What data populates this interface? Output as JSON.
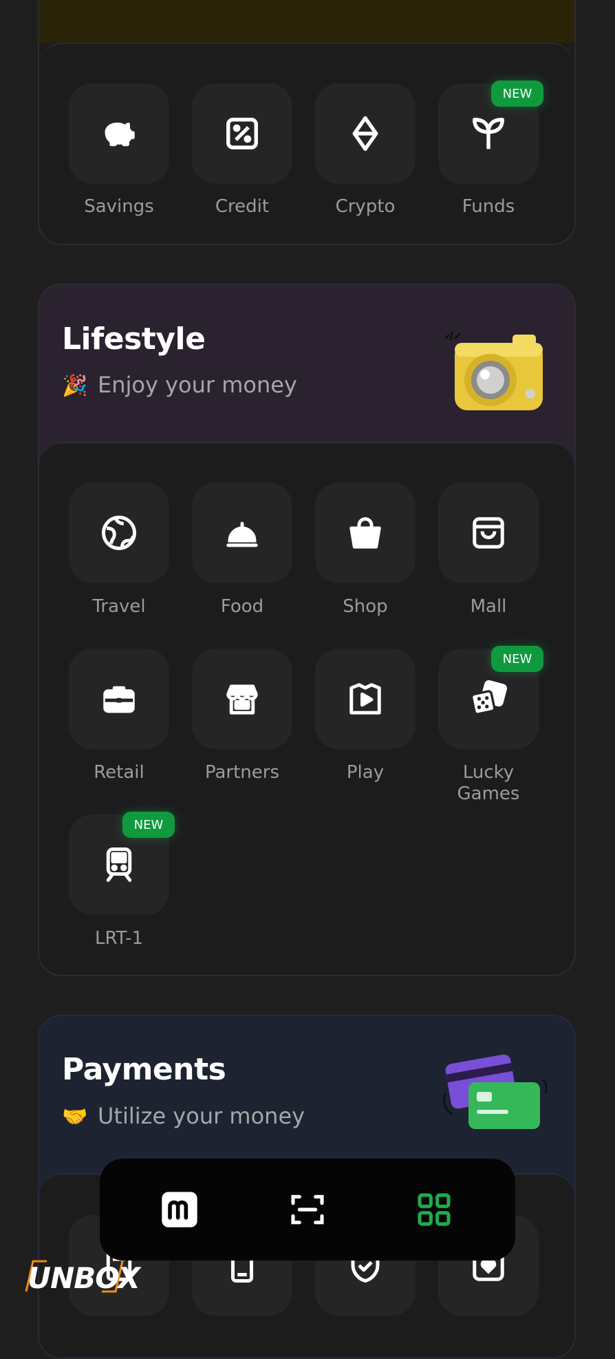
{
  "colors": {
    "background": "#1e1e1f",
    "badge": "#0f9a3e",
    "active_nav": "#1faa4e"
  },
  "top_section": {
    "items": [
      {
        "label": "Savings",
        "icon": "piggy-bank-icon"
      },
      {
        "label": "Credit",
        "icon": "percent-icon"
      },
      {
        "label": "Crypto",
        "icon": "diamond-icon"
      },
      {
        "label": "Funds",
        "icon": "sprout-icon",
        "badge": "NEW"
      }
    ]
  },
  "lifestyle": {
    "title": "Lifestyle",
    "subtitle": "Enjoy your money",
    "subtitle_emoji": "🎉",
    "items": [
      {
        "label": "Travel",
        "icon": "globe-icon"
      },
      {
        "label": "Food",
        "icon": "cloche-icon"
      },
      {
        "label": "Shop",
        "icon": "basket-icon"
      },
      {
        "label": "Mall",
        "icon": "shopping-bag-icon"
      },
      {
        "label": "Retail",
        "icon": "briefcase-icon"
      },
      {
        "label": "Partners",
        "icon": "storefront-icon"
      },
      {
        "label": "Play",
        "icon": "play-book-icon"
      },
      {
        "label": "Lucky\nGames",
        "icon": "dice-icon",
        "badge": "NEW"
      },
      {
        "label": "LRT-1",
        "icon": "train-icon",
        "badge": "NEW"
      }
    ]
  },
  "payments": {
    "title": "Payments",
    "subtitle": "Utilize your money",
    "subtitle_emoji": "🤝"
  },
  "bottom_nav": {
    "items": [
      {
        "icon": "maya-logo-icon"
      },
      {
        "icon": "scan-icon"
      },
      {
        "icon": "grid-icon",
        "active": true
      }
    ]
  },
  "watermark": "UNBOX"
}
